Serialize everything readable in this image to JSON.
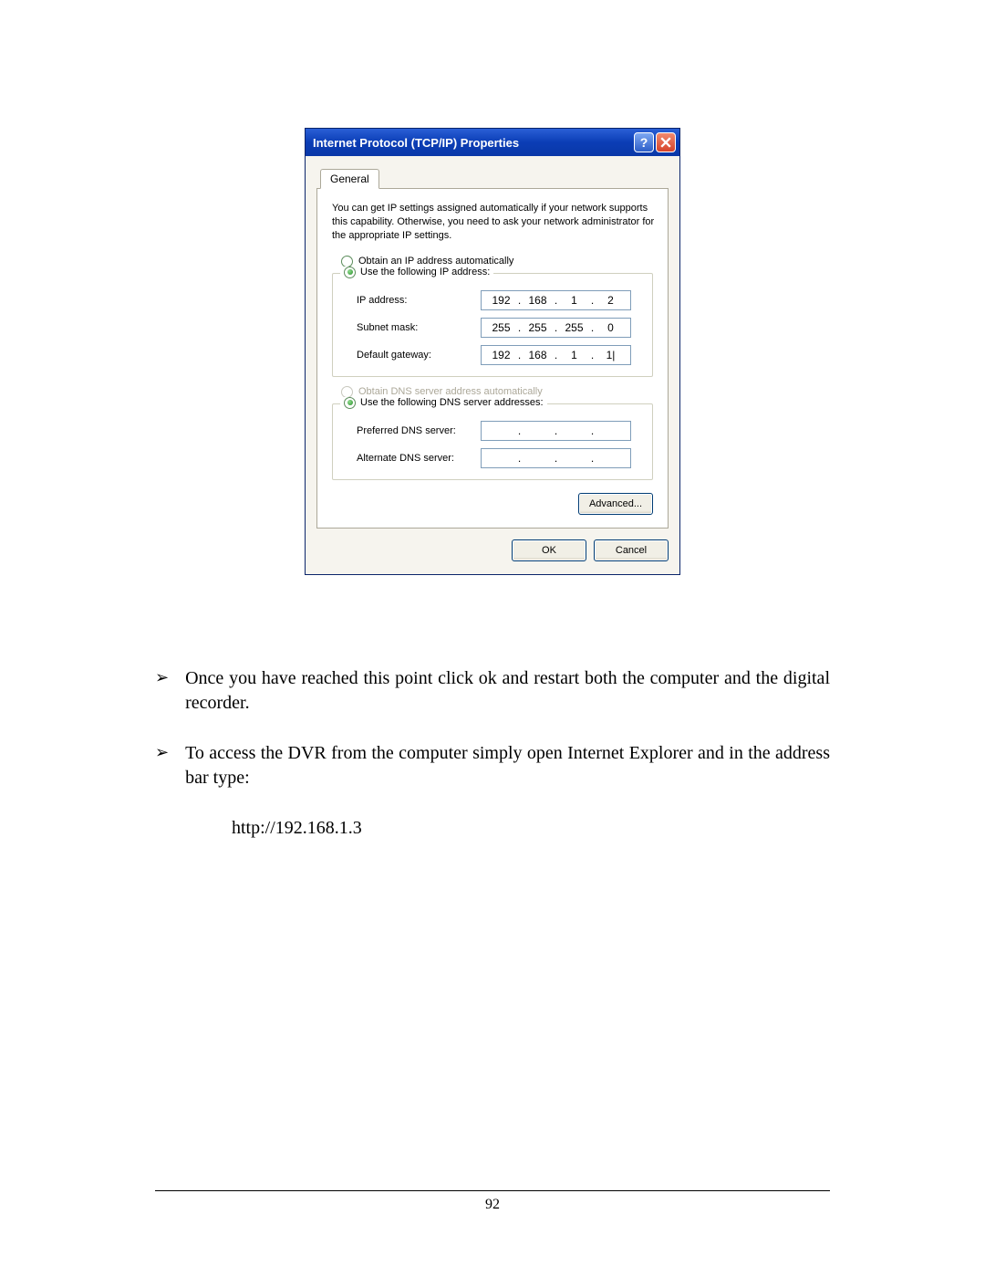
{
  "dialog": {
    "title": "Internet Protocol (TCP/IP) Properties",
    "tab": "General",
    "intro": "You can get IP settings assigned automatically if your network supports this capability. Otherwise, you need to ask your network administrator for the appropriate IP settings.",
    "radio_obtain_ip": "Obtain an IP address automatically",
    "radio_use_ip": "Use the following IP address:",
    "ip_address_label": "IP address:",
    "subnet_label": "Subnet mask:",
    "gateway_label": "Default gateway:",
    "ip_address": {
      "o1": "192",
      "o2": "168",
      "o3": "1",
      "o4": "2"
    },
    "subnet": {
      "o1": "255",
      "o2": "255",
      "o3": "255",
      "o4": "0"
    },
    "gateway": {
      "o1": "192",
      "o2": "168",
      "o3": "1",
      "o4": "1|"
    },
    "radio_obtain_dns": "Obtain DNS server address automatically",
    "radio_use_dns": "Use the following DNS server addresses:",
    "pref_dns_label": "Preferred DNS server:",
    "alt_dns_label": "Alternate DNS server:",
    "pref_dns": {
      "o1": "",
      "o2": "",
      "o3": "",
      "o4": ""
    },
    "alt_dns": {
      "o1": "",
      "o2": "",
      "o3": "",
      "o4": ""
    },
    "advanced_btn": "Advanced...",
    "ok_btn": "OK",
    "cancel_btn": "Cancel"
  },
  "doc": {
    "bullet1": "Once you have reached this point click ok and restart both the computer and the digital recorder.",
    "bullet2": "To access the DVR from the computer simply open Internet Explorer and in the address bar type:",
    "url": "http://192.168.1.3",
    "page_number": "92"
  }
}
